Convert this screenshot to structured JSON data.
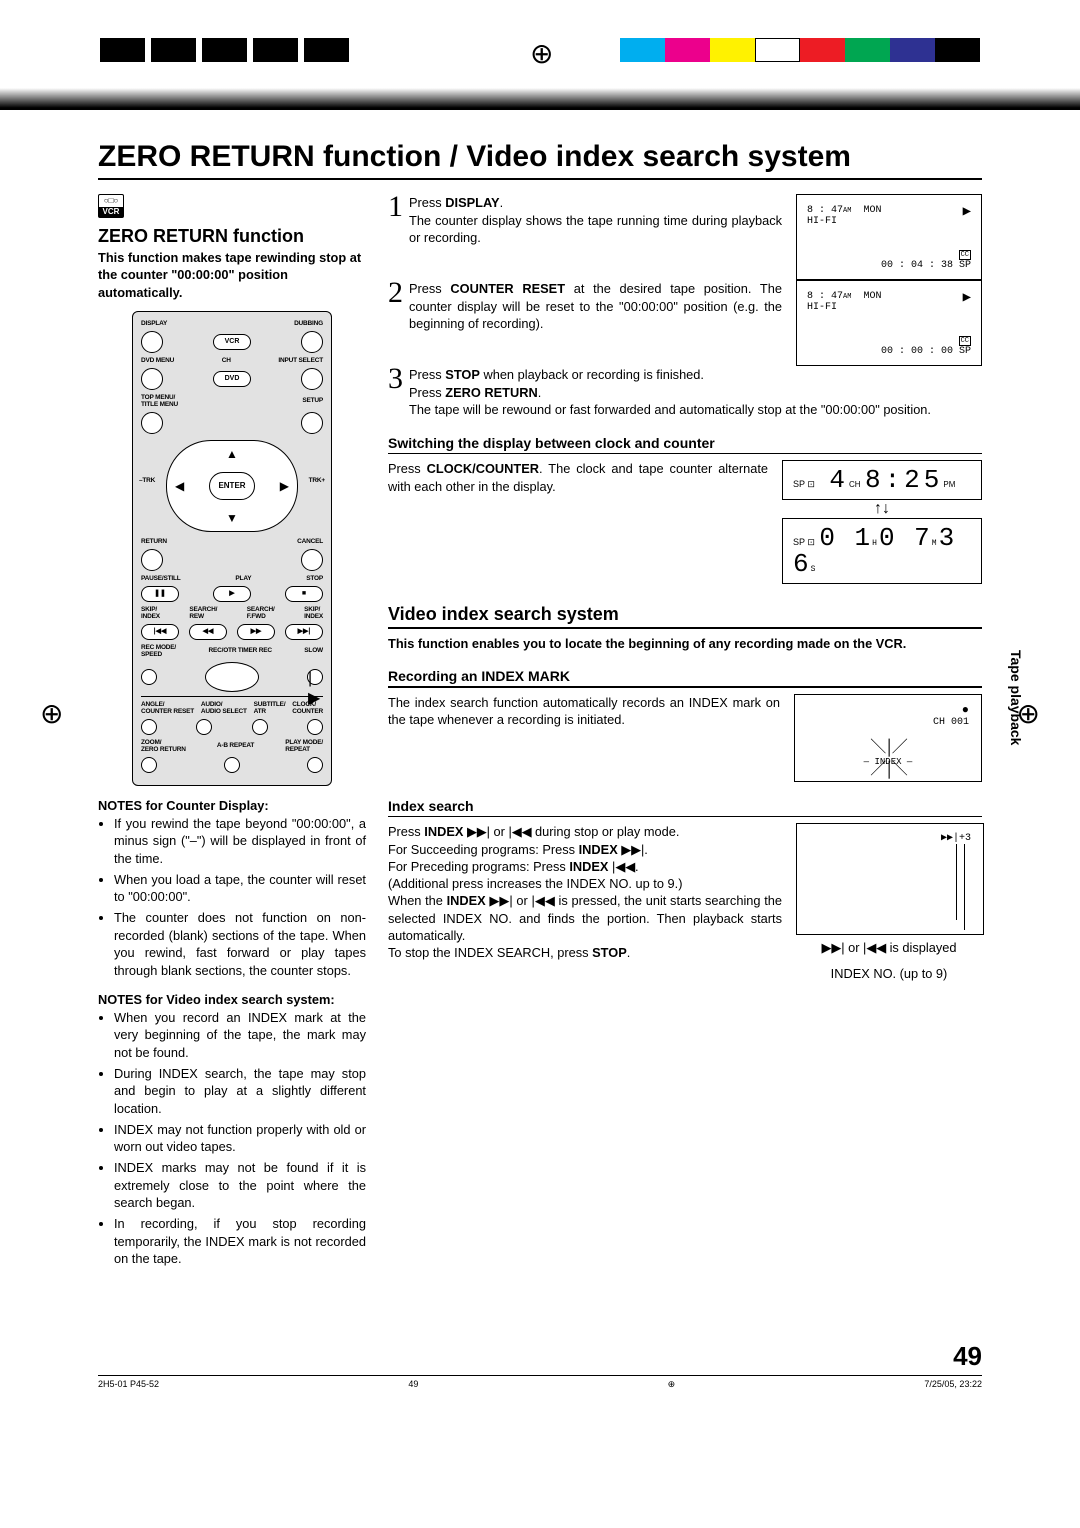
{
  "page_title": "ZERO RETURN function / Video index search system",
  "vcr_badge": {
    "line1": "○□○",
    "line2": "VCR"
  },
  "left": {
    "heading": "ZERO RETURN function",
    "intro_bold": "This function makes tape rewinding stop at the counter \"00:00:00\" position automatically.",
    "remote_labels": {
      "display": "DISPLAY",
      "dubbing": "DUBBING",
      "vcr": "VCR",
      "dvdmenu": "DVD MENU",
      "ch": "CH",
      "inputselect": "INPUT SELECT",
      "dvd": "DVD",
      "topmenu": "TOP MENU/\nTITLE MENU",
      "setup": "SETUP",
      "trk_minus": "–TRK",
      "enter": "ENTER",
      "trk_plus": "TRK+",
      "return": "RETURN",
      "cancel": "CANCEL",
      "pause": "PAUSE/STILL",
      "play": "PLAY",
      "stop": "STOP",
      "skip_index_l": "SKIP/\nINDEX",
      "search_rew": "SEARCH/\nREW",
      "search_ff": "SEARCH/\nF.FWD",
      "skip_index_r": "SKIP/\nINDEX",
      "recmode": "REC MODE/\nSPEED",
      "recotr": "REC/OTR TIMER REC",
      "slow": "SLOW",
      "angle": "ANGLE/\nCOUNTER RESET",
      "audio": "AUDIO/\nAUDIO SELECT",
      "subtitle": "SUBTITLE/\nATR",
      "clock_counter": "CLOCK/\nCOUNTER",
      "zoom": "ZOOM/\nZERO RETURN",
      "abrepeat": "A-B REPEAT",
      "playmode": "PLAY MODE/\nREPEAT"
    },
    "notes_counter_hdr": "NOTES for Counter Display:",
    "notes_counter": [
      "If you rewind the tape beyond \"00:00:00\", a minus sign (\"–\") will be displayed in front of the time.",
      "When you load a tape, the counter will reset to \"00:00:00\".",
      "The counter does not function on non-recorded (blank) sections of the tape. When you rewind, fast forward or play tapes through blank sections, the counter stops."
    ],
    "notes_viss_hdr": "NOTES for Video index search system:",
    "notes_viss": [
      "When you record an INDEX mark at the very beginning of the tape, the mark may not be found.",
      "During INDEX search, the tape may stop and begin to play at a slightly different location.",
      "INDEX may not function properly with old or worn out video tapes.",
      "INDEX marks may not be found if it is extremely close to the point where the search began.",
      "In recording, if you stop recording temporarily, the INDEX mark is not recorded on the tape."
    ]
  },
  "steps": {
    "s1": {
      "num": "1",
      "text_pre": "Press ",
      "b1": "DISPLAY",
      "text_post": ".\nThe counter display shows the tape running time during playback or recording."
    },
    "s2": {
      "num": "2",
      "text_pre": "Press ",
      "b1": "COUNTER RESET",
      "text_post": " at the desired tape position. The counter display will be reset to the \"00:00:00\" position (e.g. the beginning of recording)."
    },
    "s3": {
      "num": "3",
      "text_pre": "Press ",
      "b1": "STOP",
      "mid": " when playback or recording is finished.\nPress ",
      "b2": "ZERO RETURN",
      "text_post": ".\nThe tape will be rewound or fast forwarded and automatically stop at the \"00:00:00\" position."
    }
  },
  "osd1": {
    "time": "8 : 47",
    "ampm": "AM",
    "day": "MON",
    "hifi": "HI-FI",
    "counter": "00 : 04 : 38",
    "sp": "SP",
    "cc": "CC"
  },
  "osd2": {
    "time": "8 : 47",
    "ampm": "AM",
    "day": "MON",
    "hifi": "HI-FI",
    "counter": "00 : 00 : 00",
    "sp": "SP",
    "cc": "CC"
  },
  "switch": {
    "heading": "Switching the display between clock and counter",
    "text": "Press CLOCK/COUNTER. The clock and tape counter alternate with each other in the display.",
    "text_pre": "Press ",
    "b1": "CLOCK/COUNTER",
    "text_post": ". The clock and tape counter alternate with each other in the display.",
    "vfd1_left": "SP  ⊡",
    "vfd1_ch": "4",
    "vfd1_chTiny": "CH",
    "vfd1_clock": "8:25",
    "vfd1_pm": "PM",
    "vfd_arrows": "↑↓",
    "vfd2_left": "SP  ⊡",
    "vfd2_counter": "0 1 0 7 3 6",
    "vfd2_h": "H",
    "vfd2_m": "M",
    "vfd2_s": "S"
  },
  "viss": {
    "heading": "Video index search system",
    "intro_bold": "This function enables you to locate the beginning of any recording made on the VCR.",
    "rec_heading": "Recording an INDEX MARK",
    "rec_text": "The index search function automatically records an INDEX mark on the tape whenever a recording is initiated.",
    "rec_osd": {
      "rec_dot": "●",
      "ch": "CH  001",
      "index": "INDEX"
    },
    "idx_heading": "Index search",
    "idx_lines": {
      "l1_pre": "Press ",
      "l1_b": "INDEX",
      "l1_sym": " ▶▶| or |◀◀ ",
      "l1_post": " during stop or play mode.",
      "l2": "For Succeeding programs: Press ",
      "l2_b": "INDEX",
      "l2_sym": " ▶▶|.",
      "l3": "For Preceding programs: Press ",
      "l3_b": "INDEX",
      "l3_sym": " |◀◀.",
      "l4": "(Additional press increases the INDEX NO. up to 9.)",
      "l5_pre": "When the ",
      "l5_b": "INDEX",
      "l5_sym": "  ▶▶| or |◀◀",
      "l5_mid": " is pressed, the unit starts searching the selected INDEX NO. and finds the portion. Then playback starts automatically.",
      "l6": "To stop the INDEX SEARCH, press ",
      "l6_b": "STOP",
      "l6_post": "."
    },
    "idx_osd": {
      "corner": "▶▶|+3",
      "caption1": "▶▶| or |◀◀ is displayed",
      "caption2": "INDEX NO. (up to 9)"
    }
  },
  "tab_text": "Tape playback",
  "page_number": "49",
  "footer": {
    "left": "2H5-01 P45-52",
    "mid": "49",
    "right": "7/25/05, 23:22"
  }
}
